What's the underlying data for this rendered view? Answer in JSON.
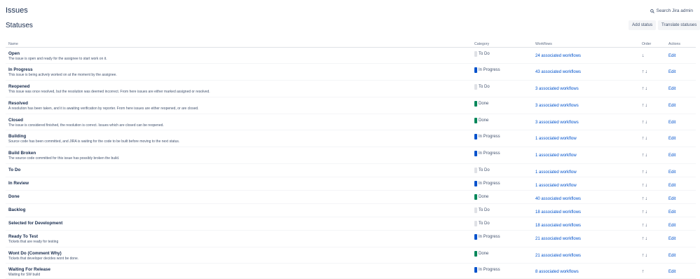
{
  "page_title": "Issues",
  "search_label": "Search Jira admin",
  "section_title": "Statuses",
  "buttons": {
    "add": "Add status",
    "translate": "Translate statuses"
  },
  "columns": {
    "name": "Name",
    "category": "Category",
    "workflows": "Workflows",
    "order": "Order",
    "actions": "Actions"
  },
  "category_colors": {
    "To Do": "#dfe1e6",
    "In Progress": "#0052cc",
    "Done": "#00875a"
  },
  "rows": [
    {
      "name": "Open",
      "description": "The issue is open and ready for the assignee to start work on it.",
      "category": "To Do",
      "workflows": "24 associated workflows",
      "order": "↓",
      "action": "Edit"
    },
    {
      "name": "In Progress",
      "description": "This issue is being actively worked on at the moment by the assignee.",
      "category": "In Progress",
      "workflows": "43 associated workflows",
      "order": "↑↓",
      "action": "Edit"
    },
    {
      "name": "Reopened",
      "description": "This issue was once resolved, but the resolution was deemed incorrect. From here issues are either marked assigned or resolved.",
      "category": "To Do",
      "workflows": "3 associated workflows",
      "order": "↑↓",
      "action": "Edit"
    },
    {
      "name": "Resolved",
      "description": "A resolution has been taken, and it is awaiting verification by reporter. From here issues are either reopened, or are closed.",
      "category": "Done",
      "workflows": "3 associated workflows",
      "order": "↑↓",
      "action": "Edit"
    },
    {
      "name": "Closed",
      "description": "The issue is considered finished, the resolution is correct. Issues which are closed can be reopened.",
      "category": "Done",
      "workflows": "3 associated workflows",
      "order": "↑↓",
      "action": "Edit"
    },
    {
      "name": "Building",
      "description": "Source code has been committed, and JIRA is waiting for the code to be built before moving to the next status.",
      "category": "In Progress",
      "workflows": "1 associated workflow",
      "order": "↑↓",
      "action": "Edit"
    },
    {
      "name": "Build Broken",
      "description": "The source code committed for this issue has possibly broken the build.",
      "category": "In Progress",
      "workflows": "1 associated workflow",
      "order": "↑↓",
      "action": "Edit"
    },
    {
      "name": "To Do",
      "description": "",
      "category": "To Do",
      "workflows": "1 associated workflow",
      "order": "↑↓",
      "action": "Edit"
    },
    {
      "name": "In Review",
      "description": "",
      "category": "In Progress",
      "workflows": "1 associated workflow",
      "order": "↑↓",
      "action": "Edit"
    },
    {
      "name": "Done",
      "description": "",
      "category": "Done",
      "workflows": "40 associated workflows",
      "order": "↑↓",
      "action": "Edit"
    },
    {
      "name": "Backlog",
      "description": "",
      "category": "To Do",
      "workflows": "18 associated workflows",
      "order": "↑↓",
      "action": "Edit"
    },
    {
      "name": "Selected for Development",
      "description": "",
      "category": "To Do",
      "workflows": "18 associated workflows",
      "order": "↑↓",
      "action": "Edit"
    },
    {
      "name": "Ready To Test",
      "description": "Tickets that are ready for testing",
      "category": "In Progress",
      "workflows": "21 associated workflows",
      "order": "↑↓",
      "action": "Edit"
    },
    {
      "name": "Wont Do (Comment Why)",
      "description": "Tickets that developer decides wont be done.",
      "category": "Done",
      "workflows": "21 associated workflows",
      "order": "↑↓",
      "action": "Edit"
    },
    {
      "name": "Waiting For Release",
      "description": "Waiting for SW build",
      "category": "In Progress",
      "workflows": "8 associated workflows",
      "order": "↑",
      "action": "Edit"
    }
  ]
}
